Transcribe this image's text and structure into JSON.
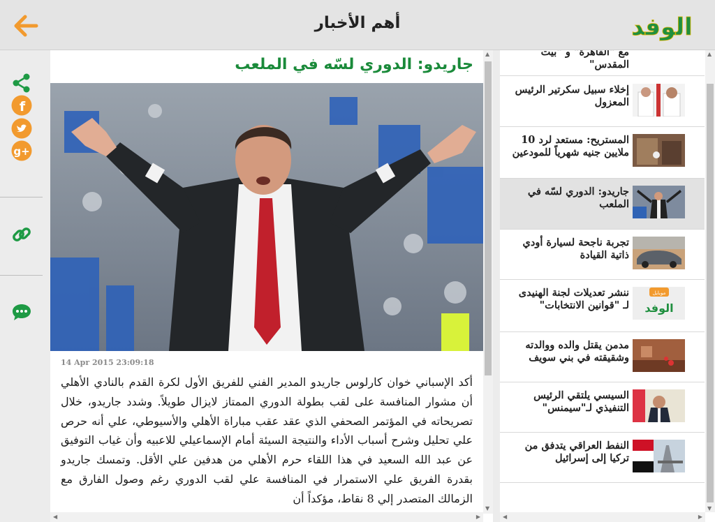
{
  "header": {
    "title": "أهم الأخبار",
    "logo_text": "الوفد",
    "back_icon": "arrow-left-icon",
    "accent_color": "#f29a2e",
    "brand_color": "#1f8f3f"
  },
  "share": {
    "icons": [
      "share-icon",
      "facebook-icon",
      "twitter-icon",
      "google-plus-icon",
      "link-icon",
      "comments-icon"
    ],
    "google_plus_label": "g+"
  },
  "article": {
    "title": "جاريدو: الدوري لسّه في الملعب",
    "timestamp": "14 Apr 2015 23:09:18",
    "body": "أكد الإسباني خوان كارلوس جاريدو المدير الفني للفريق الأول لكرة القدم بالنادي الأهلي أن مشوار المنافسة على لقب بطولة الدوري الممتاز لايزال طويلاً. وشدد جاريدو، خلال تصريحاته في المؤتمر الصحفي الذي عقد عقب مباراة الأهلي والأسيوطي، علي أنه حرص علي تحليل وشرح أسباب الأداء والنتيجة السيئة أمام الإسماعيلي للاعبيه وأن غياب التوفيق عن عبد الله السعيد في هذا اللقاء حرم الأهلي من هدفين علي الأقل. وتمسك جاريدو بقدرة الفريق علي الاستمرار في المنافسة علي لقب الدوري رغم وصول الفارق مع الزمالك المتصدر إلي 8 نقاط، مؤكداً أن"
  },
  "sidebar": {
    "items": [
      {
        "title": "مع \"القاهرة\" و \"بيت المقدس\""
      },
      {
        "title": "إخلاء سبيل سكرتير الرئيس المعزول"
      },
      {
        "title": "المستريح: مستعد لرد 10 ملايين جنيه شهرياً للمودعين"
      },
      {
        "title": "جاريدو: الدوري لسّه في الملعب",
        "active": true
      },
      {
        "title": "تجربة ناجحة لسيارة أودي ذاتية القيادة"
      },
      {
        "title": "ننشر تعديلات لجنة الهنيدى لـ \"قوانين الانتخابات\""
      },
      {
        "title": "مدمن يقتل والده ووالدته وشقيقته في بني سويف"
      },
      {
        "title": "السيسي يلتقي الرئيس التنفيذي لـ\"سيمنس\""
      },
      {
        "title": "النفط العراقي يتدفق من تركيا إلى إسرائيل"
      }
    ],
    "mobile_badge": "موبايل",
    "mobile_logo": "الوفد"
  }
}
